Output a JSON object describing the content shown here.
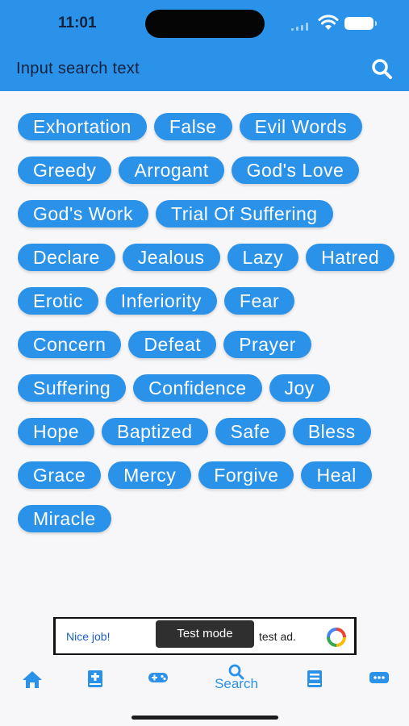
{
  "status_bar": {
    "time": "11:01"
  },
  "search": {
    "placeholder": "Input search text"
  },
  "tags": [
    "Exhortation",
    "False",
    "Evil Words",
    "Greedy",
    "Arrogant",
    "God's Love",
    "God's Work",
    "Trial Of Suffering",
    "Declare",
    "Jealous",
    "Lazy",
    "Hatred",
    "Erotic",
    "Inferiority",
    "Fear",
    "Concern",
    "Defeat",
    "Prayer",
    "Suffering",
    "Confidence",
    "Joy",
    "Hope",
    "Baptized",
    "Safe",
    "Bless",
    "Grace",
    "Mercy",
    "Forgive",
    "Heal",
    "Miracle"
  ],
  "ad": {
    "left_text": "Nice job!",
    "right_text": "test ad.",
    "badge": "Test mode"
  },
  "bottom_nav": {
    "active_label": "Search",
    "items": [
      "home-icon",
      "bible-icon",
      "gamepad-icon",
      "search-icon",
      "book-icon",
      "chat-icon"
    ]
  },
  "colors": {
    "accent": "#2b92ea",
    "background": "#f7f7f9",
    "text_dark": "#14213d"
  }
}
